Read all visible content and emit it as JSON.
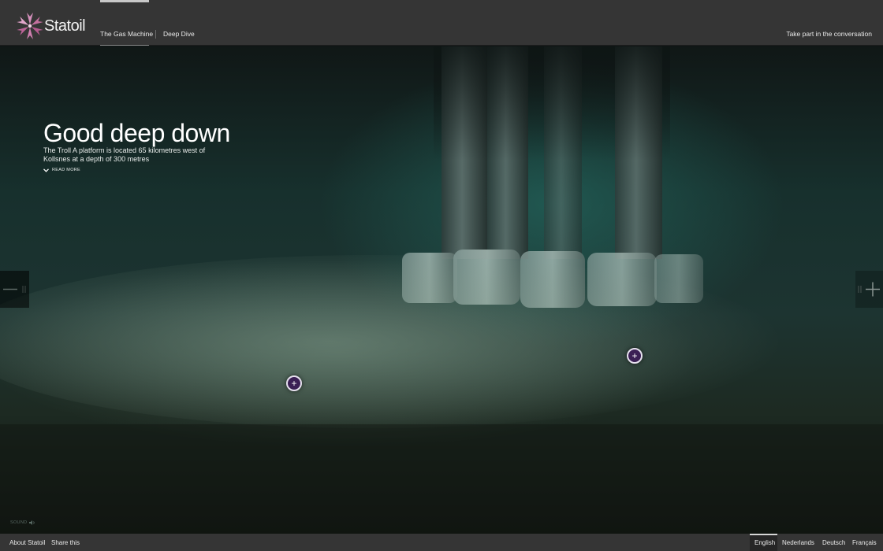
{
  "brand": {
    "name": "Statoil"
  },
  "nav": {
    "items": [
      {
        "label": "The Gas Machine",
        "active": true
      },
      {
        "label": "Deep Dive",
        "active": false
      }
    ],
    "right_link": "Take part in the conversation"
  },
  "hero": {
    "title": "Good deep down",
    "subtitle": "The Troll A platform is located 65 kilometres west of Kollsnes at a depth of 300 metres",
    "read_more": "READ MORE"
  },
  "sound": {
    "label": "SOUND"
  },
  "footer": {
    "left_links": [
      "About Statoil",
      "Share this"
    ],
    "languages": [
      {
        "label": "English",
        "active": true
      },
      {
        "label": "Nederlands",
        "active": false
      },
      {
        "label": "Deutsch",
        "active": false
      },
      {
        "label": "Français",
        "active": false
      }
    ]
  },
  "colors": {
    "bar_bg": "#353535",
    "brand_pink": "#c2709f",
    "hotspot_purple": "#3b1f55"
  },
  "icons": [
    "statoil-star-logo",
    "chevron-down-icon",
    "plus-icon",
    "minus-icon",
    "speaker-icon"
  ]
}
